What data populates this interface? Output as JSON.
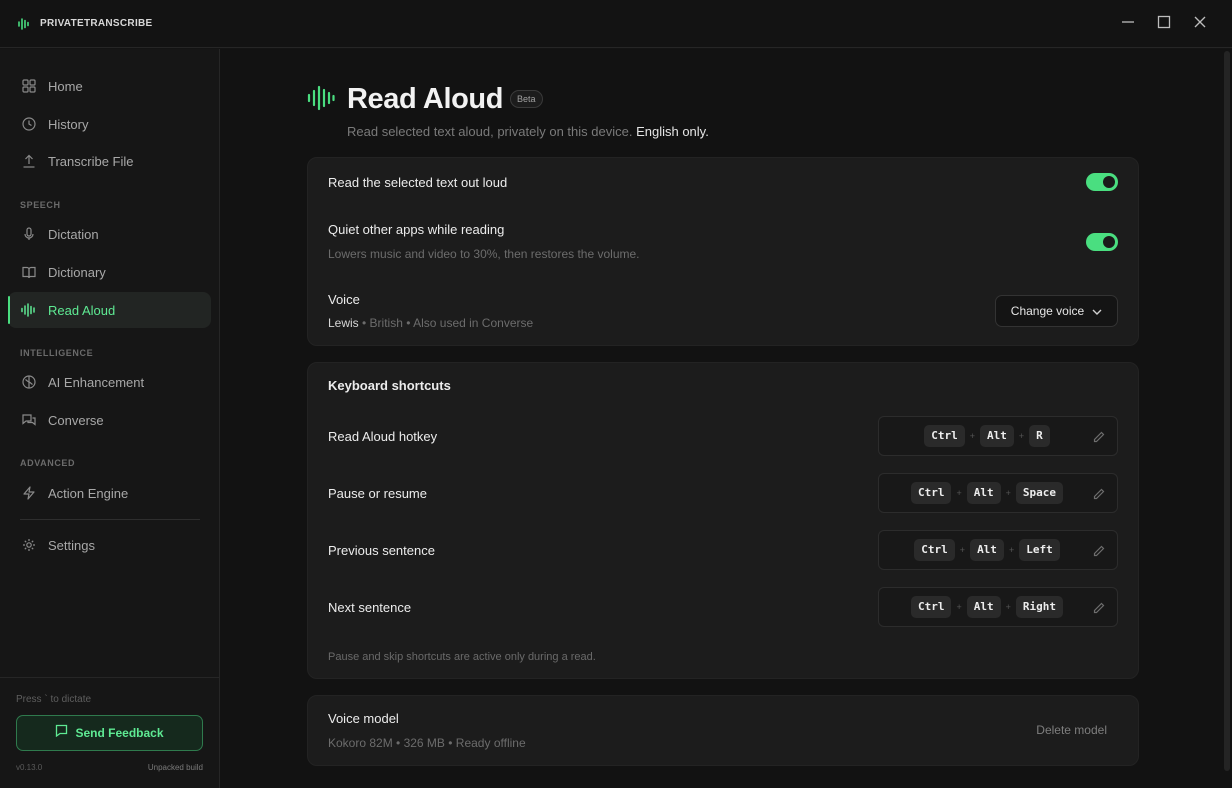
{
  "app": {
    "name": "PRIVATETRANSCRIBE"
  },
  "window_controls": {
    "minimize": "minimize-icon",
    "maximize": "maximize-icon",
    "close": "close-icon"
  },
  "sidebar": {
    "items": [
      {
        "label": "Home",
        "icon": "home-icon"
      },
      {
        "label": "History",
        "icon": "history-icon"
      },
      {
        "label": "Transcribe File",
        "icon": "upload-icon"
      },
      {
        "label": "Dictation",
        "icon": "microphone-icon"
      },
      {
        "label": "Dictionary",
        "icon": "book-icon"
      },
      {
        "label": "Read Aloud",
        "icon": "waveform-icon",
        "active": true
      },
      {
        "label": "AI Enhancement",
        "icon": "brain-icon"
      },
      {
        "label": "Converse",
        "icon": "chat-icon"
      },
      {
        "label": "Action Engine",
        "icon": "bolt-icon"
      },
      {
        "label": "Settings",
        "icon": "gear-icon"
      }
    ],
    "sections": {
      "speech": "SPEECH",
      "intelligence": "INTELLIGENCE",
      "advanced": "ADVANCED"
    },
    "hint": "Press ` to dictate",
    "feedback_label": "Send Feedback",
    "version": "v0.13.0",
    "build": "Unpacked build"
  },
  "page": {
    "title": "Read Aloud",
    "badge": "Beta",
    "subtitle": "Read selected text aloud, privately on this device.",
    "subtitle_emphasis": "English only."
  },
  "settings": {
    "read_selected": {
      "title": "Read the selected text out loud",
      "enabled": true
    },
    "quiet_apps": {
      "title": "Quiet other apps while reading",
      "description": "Lowers music and video to 30%, then restores the volume.",
      "enabled": true
    },
    "voice": {
      "title": "Voice",
      "name": "Lewis",
      "details": " • British • Also used in Converse",
      "button": "Change voice"
    }
  },
  "shortcuts": {
    "title": "Keyboard shortcuts",
    "items": [
      {
        "label": "Read Aloud hotkey",
        "keys": [
          "Ctrl",
          "Alt",
          "R"
        ]
      },
      {
        "label": "Pause or resume",
        "keys": [
          "Ctrl",
          "Alt",
          "Space"
        ]
      },
      {
        "label": "Previous sentence",
        "keys": [
          "Ctrl",
          "Alt",
          "Left"
        ]
      },
      {
        "label": "Next sentence",
        "keys": [
          "Ctrl",
          "Alt",
          "Right"
        ]
      }
    ],
    "plus": "+",
    "footnote": "Pause and skip shortcuts are active only during a read."
  },
  "voice_model": {
    "title": "Voice model",
    "details": "Kokoro 82M • 326 MB • Ready offline",
    "delete_label": "Delete model"
  },
  "colors": {
    "accent": "#4ade80",
    "background": "#121212",
    "card": "#1c1c1c"
  }
}
